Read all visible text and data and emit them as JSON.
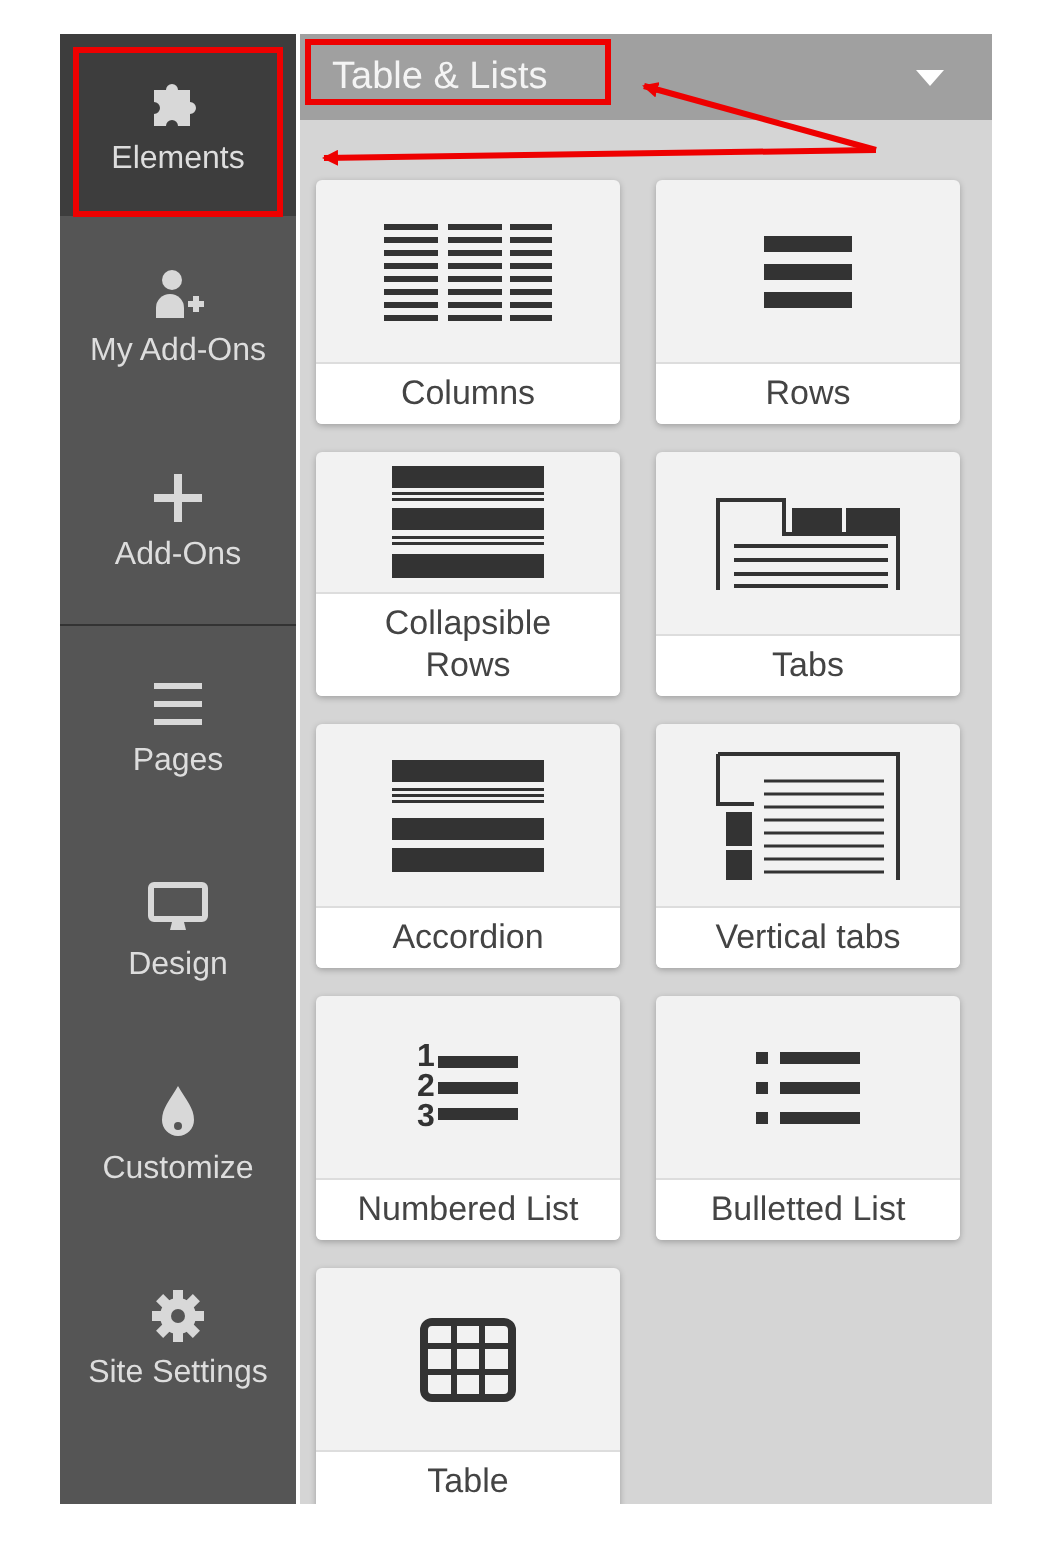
{
  "sidebar": {
    "sections": [
      {
        "items": [
          {
            "label": "Elements",
            "kind": "puzzle",
            "selected": true
          },
          {
            "label": "My Add-Ons",
            "kind": "user-plus",
            "selected": false
          },
          {
            "label": "Add-Ons",
            "kind": "plus",
            "selected": false
          }
        ]
      },
      {
        "items": [
          {
            "label": "Pages",
            "kind": "bars",
            "selected": false
          },
          {
            "label": "Design",
            "kind": "monitor",
            "selected": false
          },
          {
            "label": "Customize",
            "kind": "drop",
            "selected": false
          },
          {
            "label": "Site Settings",
            "kind": "gear",
            "selected": false
          }
        ]
      }
    ]
  },
  "panel": {
    "title": "Table & Lists",
    "expanded": true,
    "tiles": [
      {
        "label": "Columns",
        "kind": "columns"
      },
      {
        "label": "Rows",
        "kind": "rows"
      },
      {
        "label": "Collapsible Rows",
        "kind": "collapsible"
      },
      {
        "label": "Tabs",
        "kind": "tabs"
      },
      {
        "label": "Accordion",
        "kind": "accordion"
      },
      {
        "label": "Vertical tabs",
        "kind": "vtabs"
      },
      {
        "label": "Numbered List",
        "kind": "numbered",
        "markers": [
          "1",
          "2",
          "3"
        ]
      },
      {
        "label": "Bulletted List",
        "kind": "bulleted"
      },
      {
        "label": "Table",
        "kind": "table"
      }
    ]
  }
}
